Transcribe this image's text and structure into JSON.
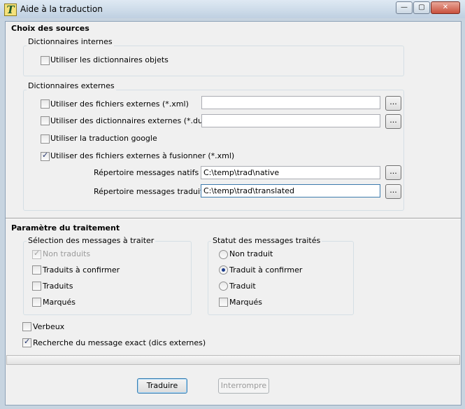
{
  "window": {
    "title": "Aide à la traduction",
    "minimize_label": "—",
    "maximize_label": "▢",
    "close_label": "✕"
  },
  "sources": {
    "title": "Choix des sources",
    "internal": {
      "legend": "Dictionnaires internes",
      "use_object_dicts": {
        "label": "Utiliser les dictionnaires objets",
        "checked": false
      }
    },
    "external": {
      "legend": "Dictionnaires externes",
      "xml_files": {
        "label": "Utiliser des fichiers externes (*.xml)",
        "checked": false,
        "value": ""
      },
      "dut_files": {
        "label": "Utiliser des dictionnaires externes (*.dut)",
        "checked": false,
        "value": ""
      },
      "google": {
        "label": "Utiliser la traduction google",
        "checked": false
      },
      "merge_files": {
        "label": "Utiliser des fichiers externes à fusionner (*.xml)",
        "checked": true
      },
      "native_dir": {
        "label": "Répertoire messages natifs :",
        "value": "C:\\temp\\trad\\native"
      },
      "translated_dir": {
        "label": "Répertoire messages traduits :",
        "value": "C:\\temp\\trad\\translated"
      },
      "browse_label": "..."
    }
  },
  "processing": {
    "title": "Paramètre du traitement",
    "selection": {
      "legend": "Sélection des messages à traiter",
      "non_traduits": {
        "label": "Non traduits",
        "checked": true,
        "disabled": true
      },
      "a_confirmer": {
        "label": "Traduits à confirmer",
        "checked": false
      },
      "traduits": {
        "label": "Traduits",
        "checked": false
      },
      "marques": {
        "label": "Marqués",
        "checked": false
      }
    },
    "status": {
      "legend": "Statut des messages traités",
      "non_traduit": {
        "label": "Non traduit",
        "checked": false
      },
      "a_confirmer": {
        "label": "Traduit à confirmer",
        "checked": true
      },
      "traduit": {
        "label": "Traduit",
        "checked": false
      },
      "marques": {
        "label": "Marqués",
        "checked": false
      }
    },
    "verbose": {
      "label": "Verbeux",
      "checked": false
    },
    "exact_search": {
      "label": "Recherche du message exact (dics externes)",
      "checked": true
    }
  },
  "progress": {
    "value": 0
  },
  "actions": {
    "translate_label": "Traduire",
    "interrupt_label": "Interrompre"
  }
}
